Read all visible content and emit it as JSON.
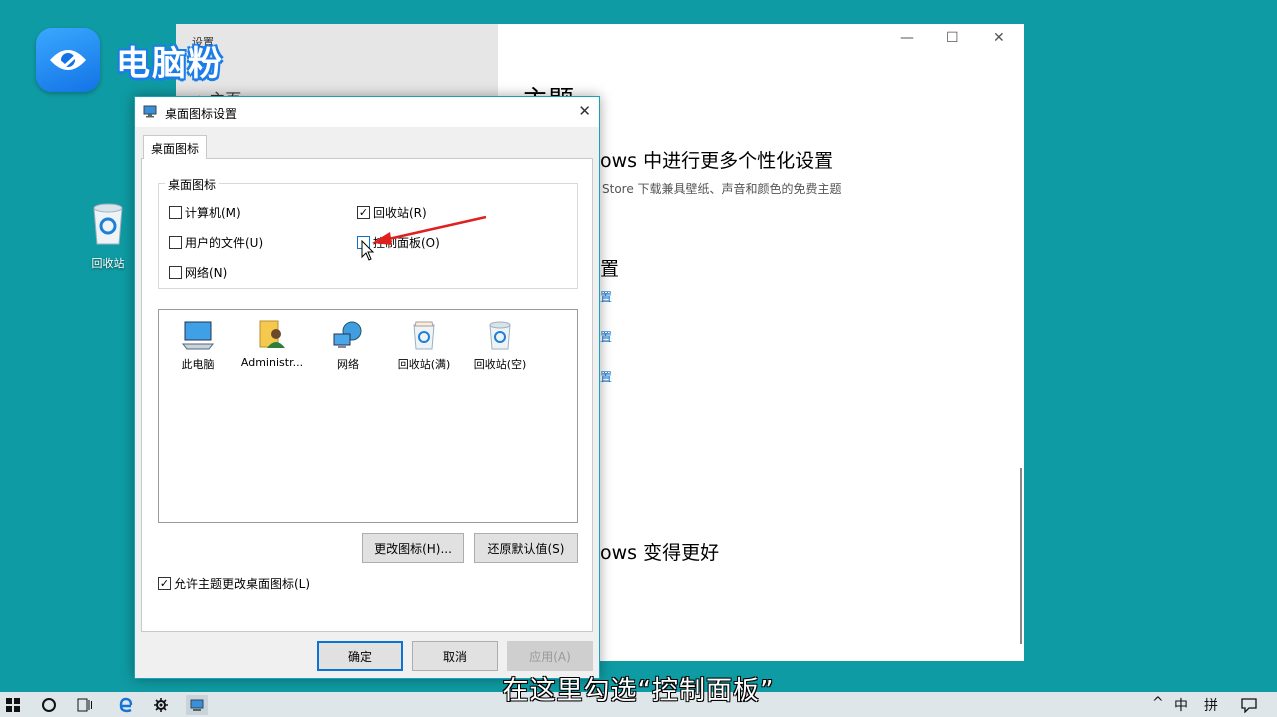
{
  "watermark": {
    "logo_text": "电脑粉"
  },
  "desktop": {
    "recycle_bin_label": "回收站"
  },
  "settings_window": {
    "nav_title": "设置",
    "home_label": "⌂  主页",
    "page_title": "主题",
    "section1_title": "ows 中进行更多个性化设置",
    "section1_sub": "Store 下载兼具壁纸、声音和颜色的免费主题",
    "section2_title": "置",
    "links": [
      "置",
      "置",
      "置"
    ],
    "section3_title": "ows 变得更好",
    "controls": {
      "minimize": "—",
      "maximize": "☐",
      "close": "✕"
    }
  },
  "dialog": {
    "title": "桌面图标设置",
    "close": "✕",
    "tab_label": "桌面图标",
    "group_label": "桌面图标",
    "checkboxes": [
      {
        "label": "计算机(M)",
        "checked": false
      },
      {
        "label": "回收站(R)",
        "checked": true
      },
      {
        "label": "用户的文件(U)",
        "checked": false
      },
      {
        "label": "控制面板(O)",
        "checked": false
      },
      {
        "label": "网络(N)",
        "checked": false
      }
    ],
    "icons": [
      {
        "label": "此电脑",
        "icon": "computer-icon"
      },
      {
        "label": "Administr...",
        "icon": "user-folder-icon"
      },
      {
        "label": "网络",
        "icon": "network-icon"
      },
      {
        "label": "回收站(满)",
        "icon": "recycle-bin-full-icon"
      },
      {
        "label": "回收站(空)",
        "icon": "recycle-bin-empty-icon"
      }
    ],
    "change_icon_button": "更改图标(H)...",
    "restore_default_button": "还原默认值(S)",
    "allow_themes_label": "允许主题更改桌面图标(L)",
    "allow_themes_checked": true,
    "ok_button": "确定",
    "cancel_button": "取消",
    "apply_button": "应用(A)"
  },
  "taskbar": {
    "start": "start-icon",
    "search": "search-circle-icon",
    "task_view": "task-view-icon",
    "edge": "edge-icon",
    "settings": "gear-icon",
    "tray_chevron": "^",
    "ime_mode": "中",
    "ime_layout": "拼",
    "notification": "notification-icon"
  },
  "subtitle": "在这里勾选“控制面板”",
  "colors": {
    "desktop": "#0f9ba3",
    "accent": "#0a74d1",
    "annotation_arrow": "#e0201e"
  }
}
